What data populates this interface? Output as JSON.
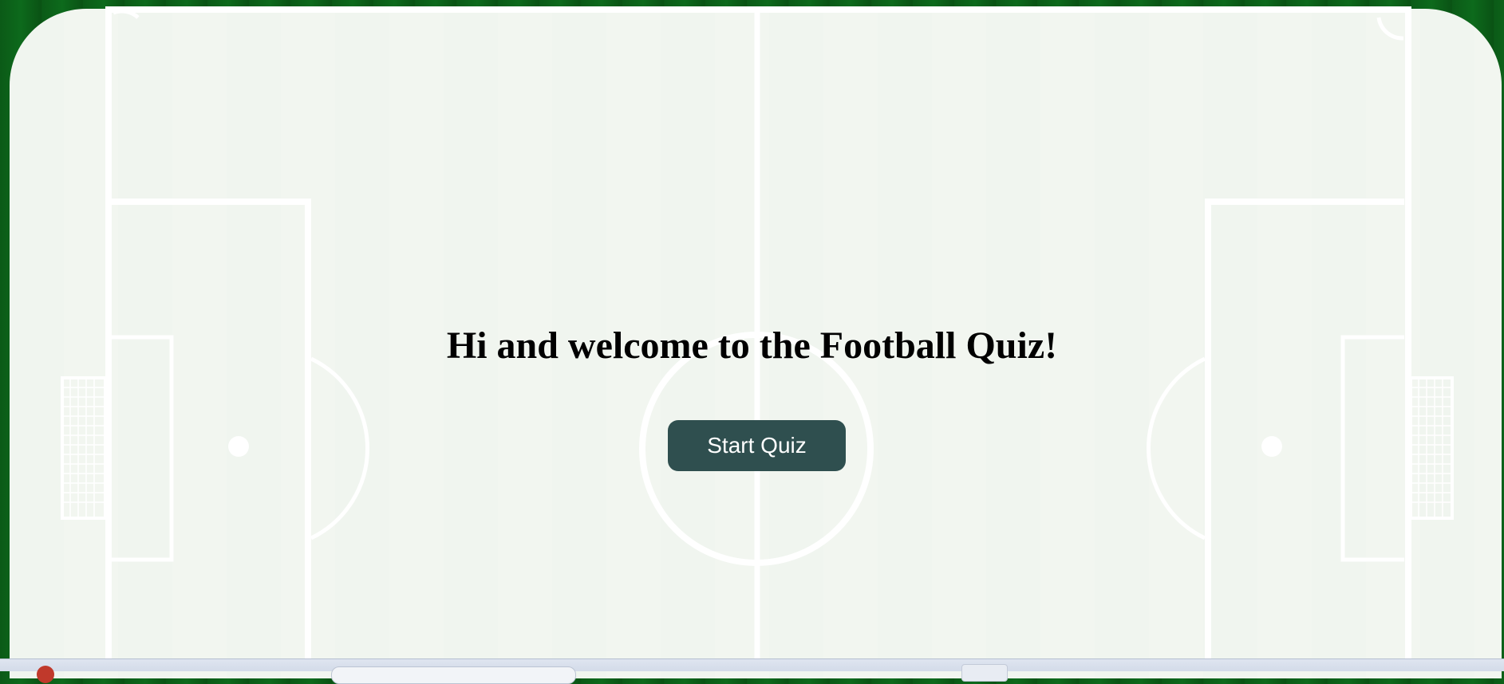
{
  "page": {
    "heading": "Hi and welcome to the Football Quiz!",
    "start_button_label": "Start Quiz"
  },
  "colors": {
    "background_grass": "#0b5a17",
    "pitch_surface": "#f0f5ef",
    "pitch_lines": "#ffffff",
    "button_bg": "#2f4f4f",
    "button_text": "#ffffff",
    "heading_text": "#000000"
  },
  "icons": {
    "taskbar_app": "app-icon"
  }
}
